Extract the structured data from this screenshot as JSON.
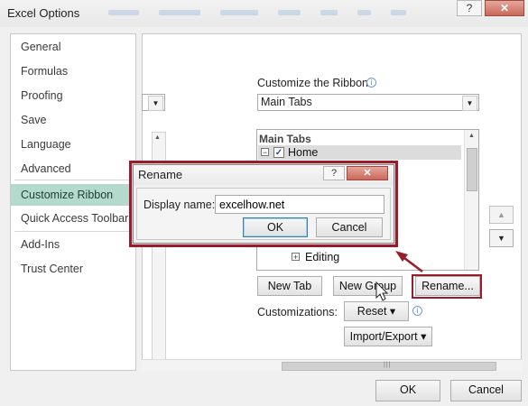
{
  "window": {
    "title": "Excel Options",
    "help_label": "?",
    "close_label": "✕"
  },
  "nav": {
    "items": [
      {
        "label": "General"
      },
      {
        "label": "Formulas"
      },
      {
        "label": "Proofing"
      },
      {
        "label": "Save"
      },
      {
        "label": "Language"
      },
      {
        "label": "Advanced"
      },
      {
        "label": "Customize Ribbon",
        "selected": true
      },
      {
        "label": "Quick Access Toolbar"
      },
      {
        "label": "Add-Ins"
      },
      {
        "label": "Trust Center"
      }
    ]
  },
  "ribbon": {
    "customize_label": "Customize the Ribbon:",
    "selected_value": "Main Tabs",
    "tree_header": "Main Tabs",
    "home_label": "Home",
    "editing_label": "Editing",
    "new_tab_label": "New Tab",
    "new_group_label": "New Group",
    "rename_label": "Rename...",
    "customizations_label": "Customizations:",
    "reset_label": "Reset ▾",
    "import_export_label": "Import/Export ▾",
    "move_up_label": "▲",
    "move_down_label": "▼"
  },
  "footer": {
    "ok_label": "OK",
    "cancel_label": "Cancel"
  },
  "rename_dialog": {
    "title": "Rename",
    "help_label": "?",
    "close_label": "✕",
    "display_name_label": "Display name:",
    "display_name_value": "excelhow.net",
    "ok_label": "OK",
    "cancel_label": "Cancel"
  },
  "colors": {
    "selected_nav_bg": "#b4d9cd",
    "highlight_red": "#9b1b2a",
    "close_button": "#c9685a"
  }
}
